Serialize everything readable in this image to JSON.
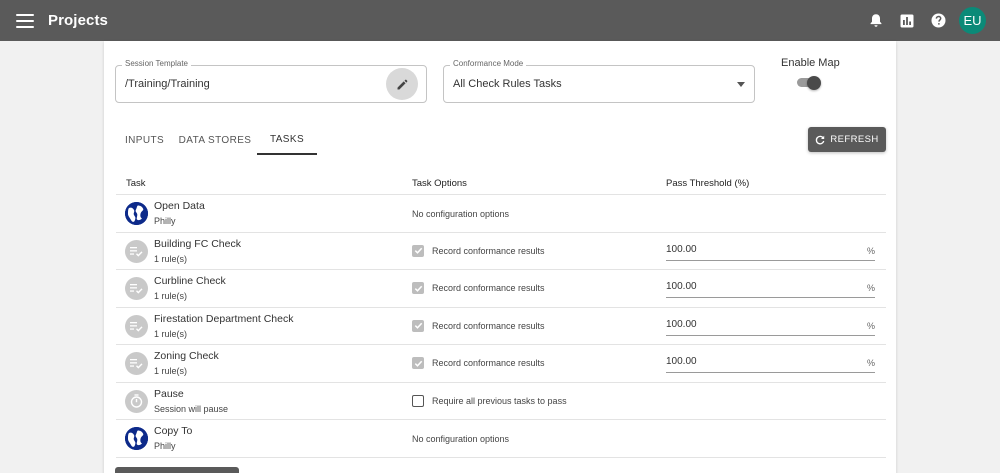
{
  "app": {
    "title": "Projects",
    "avatar_initials": "EU"
  },
  "appbar_icons": [
    "bell-icon",
    "chart-icon",
    "help-icon"
  ],
  "form": {
    "session_template": {
      "label": "Session Template",
      "value": "/Training/Training"
    },
    "conformance_mode": {
      "label": "Conformance Mode",
      "value": "All Check Rules Tasks"
    },
    "enable_map": {
      "label": "Enable Map",
      "on": true
    }
  },
  "tabs": [
    {
      "label": "INPUTS",
      "active": false
    },
    {
      "label": "DATA STORES",
      "active": false
    },
    {
      "label": "TASKS",
      "active": true
    }
  ],
  "refresh_label": "REFRESH",
  "table": {
    "headers": {
      "task": "Task",
      "options": "Task Options",
      "threshold": "Pass Threshold (%)"
    },
    "rows": [
      {
        "icon": "globe-icon",
        "name": "Open Data",
        "sub": "Philly",
        "option": "No configuration options",
        "option_type": "text"
      },
      {
        "icon": "rule-check-icon",
        "name": "Building FC Check",
        "sub": "1 rule(s)",
        "option": "Record conformance results",
        "option_type": "checked",
        "threshold": "100.00",
        "unit": "%"
      },
      {
        "icon": "rule-check-icon",
        "name": "Curbline Check",
        "sub": "1 rule(s)",
        "option": "Record conformance results",
        "option_type": "checked",
        "threshold": "100.00",
        "unit": "%"
      },
      {
        "icon": "rule-check-icon",
        "name": "Firestation Department Check",
        "sub": "1 rule(s)",
        "option": "Record conformance results",
        "option_type": "checked",
        "threshold": "100.00",
        "unit": "%"
      },
      {
        "icon": "rule-check-icon",
        "name": "Zoning Check",
        "sub": "1 rule(s)",
        "option": "Record conformance results",
        "option_type": "checked",
        "threshold": "100.00",
        "unit": "%"
      },
      {
        "icon": "stopwatch-icon",
        "name": "Pause",
        "sub": "Session will pause",
        "option": "Require all previous tasks to pass",
        "option_type": "unchecked"
      },
      {
        "icon": "globe-icon",
        "name": "Copy To",
        "sub": "Philly",
        "option": "No configuration options",
        "option_type": "text"
      }
    ]
  }
}
